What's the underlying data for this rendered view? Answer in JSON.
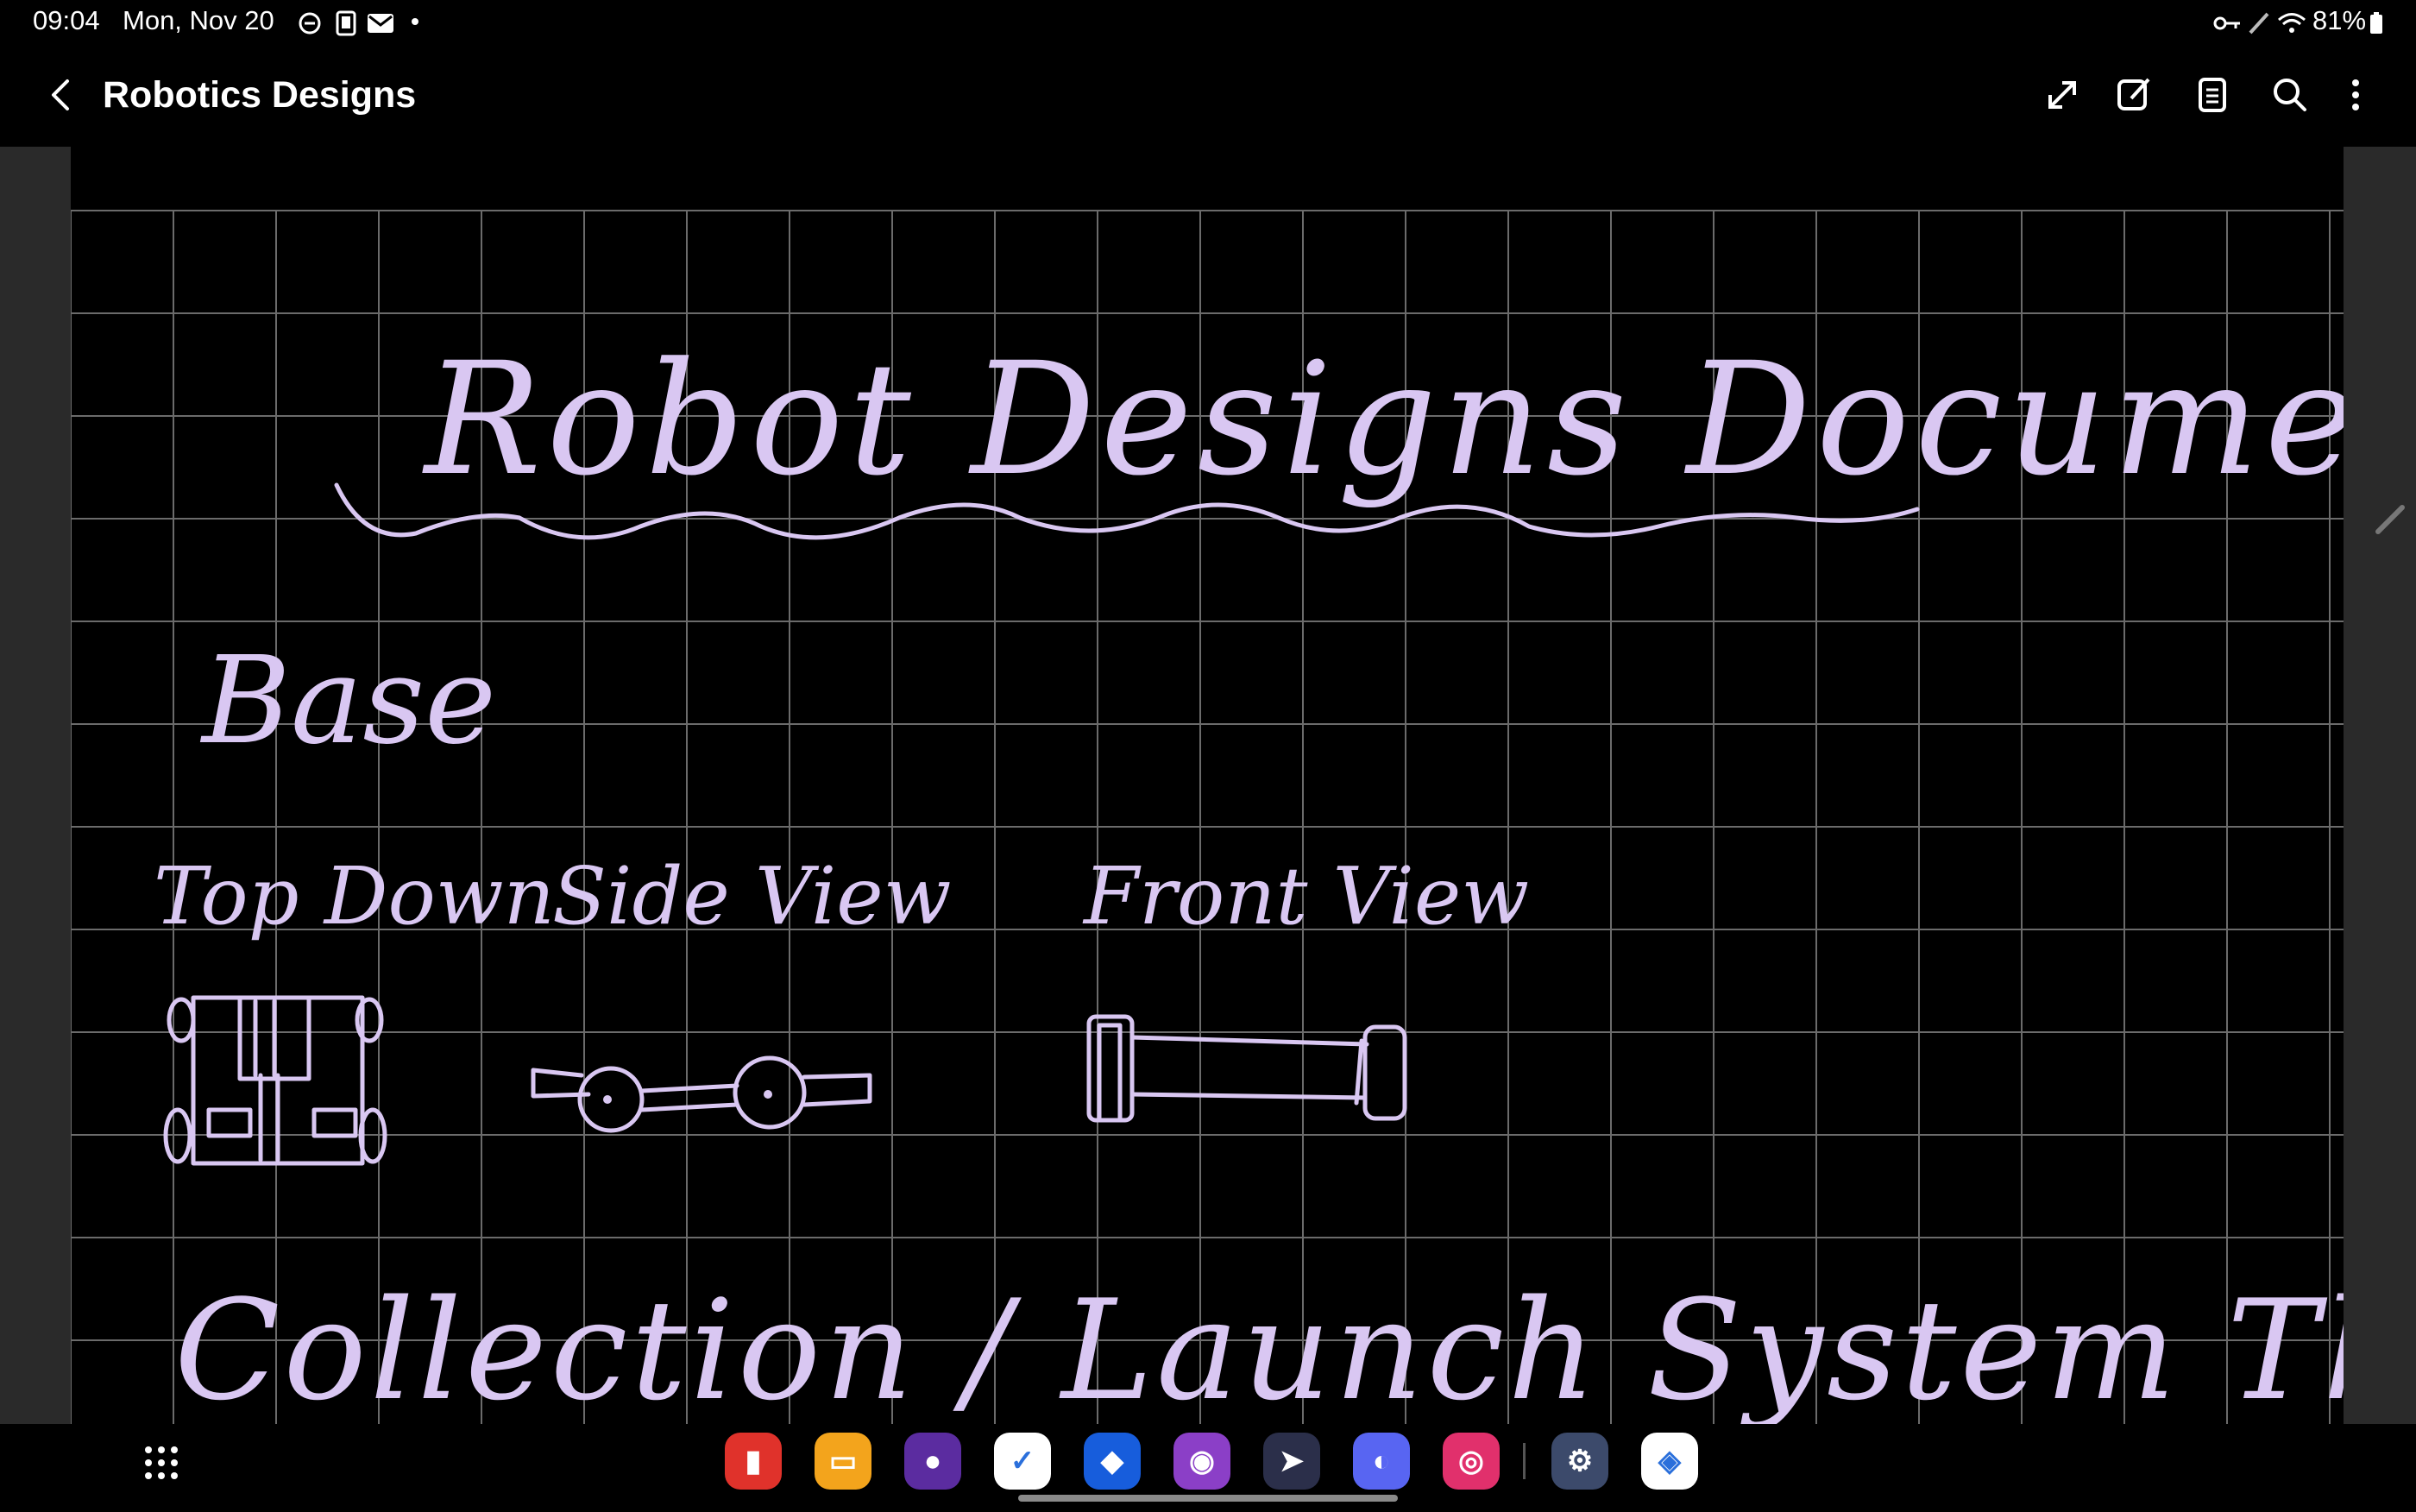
{
  "status_bar": {
    "time": "09:04",
    "date": "Mon, Nov 20",
    "battery": "81%",
    "left_icons": [
      "do-not-disturb-icon",
      "phone-screen-icon",
      "mail-icon",
      "dot-icon"
    ],
    "right_icons": [
      "key-icon",
      "pen-icon",
      "wifi-icon",
      "battery-icon"
    ]
  },
  "app_bar": {
    "title": "Robotics Designs",
    "actions": [
      "expand-icon",
      "edit-icon",
      "pages-icon",
      "search-icon",
      "more-options-icon"
    ]
  },
  "note": {
    "heading": "Robot Designs Document",
    "section": "Base",
    "views": [
      "Top Down",
      "Side View",
      "Front View"
    ],
    "next_heading": "Collection / Launch System Theory",
    "ink_color": "#d9c7f2",
    "background": "#000000",
    "grid_color": "#6b6b6b"
  },
  "taskbar": {
    "apps": [
      {
        "name": "notes-app-icon",
        "color": "#e0322b"
      },
      {
        "name": "files-app-icon",
        "color": "#f3a41c"
      },
      {
        "name": "firefox-app-icon",
        "color": "#5b2ca0"
      },
      {
        "name": "tasks-app-icon",
        "color": "#ffffff"
      },
      {
        "name": "bitwarden-app-icon",
        "color": "#175ddc"
      },
      {
        "name": "chat-app-icon",
        "color": "#8b3fc7"
      },
      {
        "name": "rocket-app-icon",
        "color": "#2b2f4a"
      },
      {
        "name": "discord-app-icon",
        "color": "#5865f2"
      },
      {
        "name": "instagram-app-icon",
        "color": "#e1306c"
      },
      {
        "name": "settings-app-icon",
        "color": "#3c4a6b"
      },
      {
        "name": "photos-app-icon",
        "color": "#ffffff"
      }
    ]
  }
}
